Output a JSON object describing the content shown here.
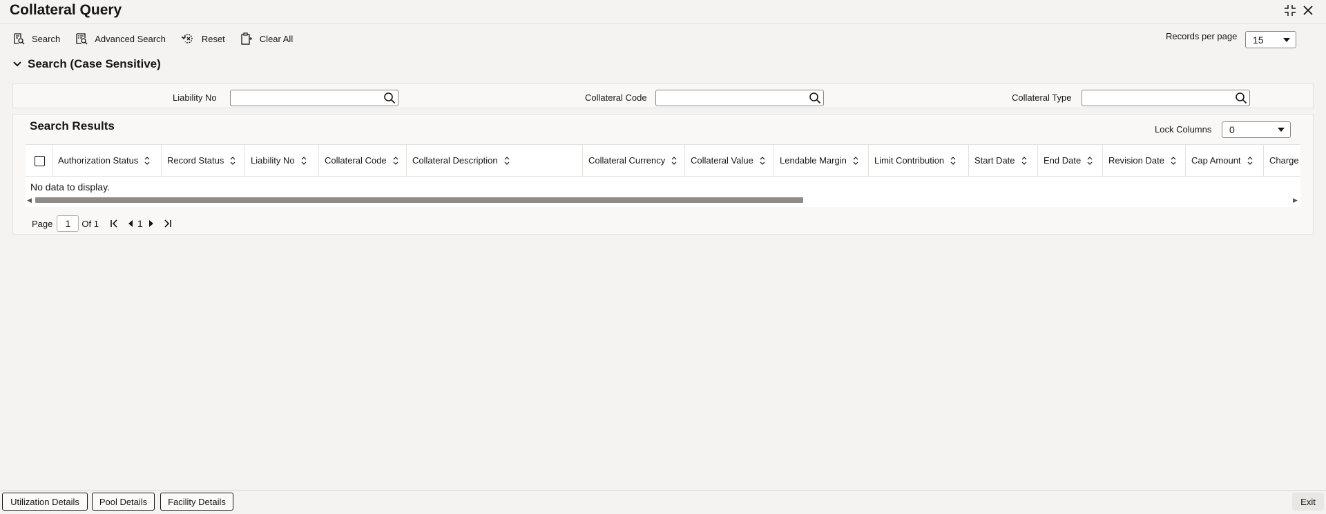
{
  "window": {
    "title": "Collateral Query",
    "controls": [
      "collapse-icon",
      "close-icon"
    ]
  },
  "toolbar": {
    "search_label": "Search",
    "advanced_search_label": "Advanced Search",
    "reset_label": "Reset",
    "clear_all_label": "Clear All"
  },
  "records_per_page": {
    "label": "Records per page",
    "value": "15"
  },
  "search_section": {
    "title": "Search (Case Sensitive)",
    "fields": [
      {
        "label": "Liability No",
        "value": ""
      },
      {
        "label": "Collateral Code",
        "value": ""
      },
      {
        "label": "Collateral Type",
        "value": ""
      }
    ]
  },
  "results": {
    "title": "Search Results",
    "lock_columns_label": "Lock Columns",
    "lock_columns_value": "0",
    "columns": [
      "Authorization Status",
      "Record Status",
      "Liability No",
      "Collateral Code",
      "Collateral Description",
      "Collateral Currency",
      "Collateral Value",
      "Lendable Margin",
      "Limit Contribution",
      "Start Date",
      "End Date",
      "Revision Date",
      "Cap Amount",
      "Charge T"
    ],
    "empty_message": "No data to display."
  },
  "pager": {
    "page_label": "Page",
    "page_value": "1",
    "of_label": "Of 1",
    "current": "1"
  },
  "footer": {
    "utilization_label": "Utilization Details",
    "pool_label": "Pool Details",
    "facility_label": "Facility Details",
    "exit_label": "Exit"
  }
}
